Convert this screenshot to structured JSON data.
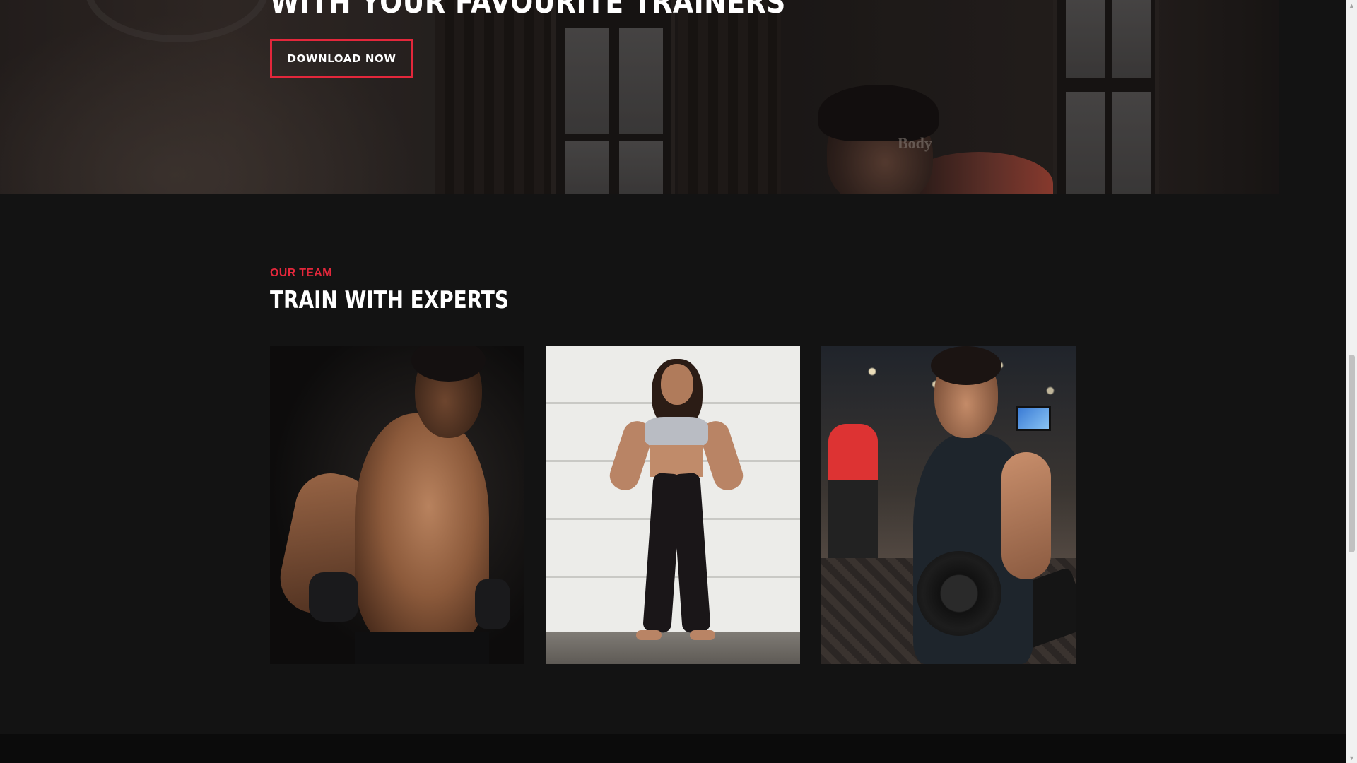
{
  "hero": {
    "title": "WITH YOUR FAVOURITE TRAINERS",
    "download_label": "DOWNLOAD NOW",
    "poster_text": "Body"
  },
  "team": {
    "eyebrow": "OUR TEAM",
    "title": "TRAIN WITH EXPERTS",
    "members": [
      {
        "photo": "boxer-trainer-photo"
      },
      {
        "photo": "fitness-trainer-woman-photo"
      },
      {
        "photo": "gym-dumbbell-trainer-photo"
      }
    ]
  },
  "colors": {
    "accent": "#e3273b",
    "background": "#131313",
    "text": "#ffffff"
  },
  "scrollbar": {
    "up_glyph": "▲",
    "down_glyph": "▼"
  }
}
